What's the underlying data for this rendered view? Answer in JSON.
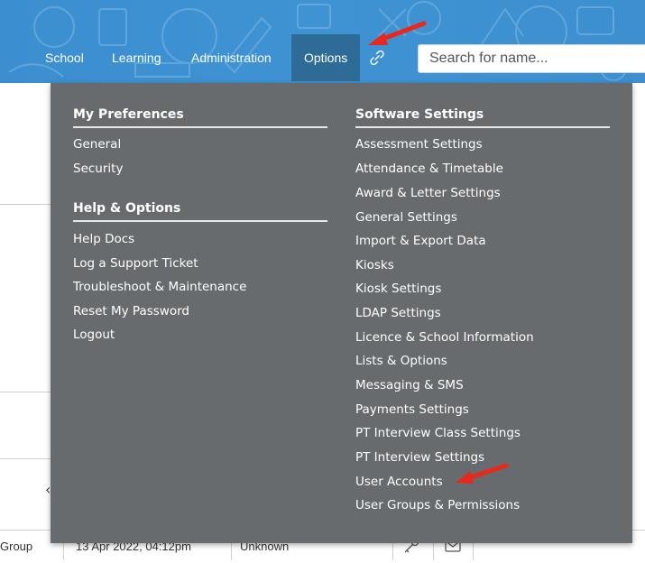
{
  "nav": {
    "items": [
      {
        "label": "School"
      },
      {
        "label": "Learning"
      },
      {
        "label": "Administration"
      },
      {
        "label": "Options"
      }
    ],
    "search_placeholder": "Search for name..."
  },
  "menu": {
    "my_preferences": {
      "heading": "My Preferences",
      "items": [
        "General",
        "Security"
      ]
    },
    "help_options": {
      "heading": "Help & Options",
      "items": [
        "Help Docs",
        "Log a Support Ticket",
        "Troubleshoot & Maintenance",
        "Reset My Password",
        "Logout"
      ]
    },
    "software_settings": {
      "heading": "Software Settings",
      "items": [
        "Assessment Settings",
        "Attendance & Timetable",
        "Award & Letter Settings",
        "General Settings",
        "Import & Export Data",
        "Kiosks",
        "Kiosk Settings",
        "LDAP Settings",
        "Licence & School Information",
        "Lists & Options",
        "Messaging & SMS",
        "Payments Settings",
        "PT Interview Class Settings",
        "PT Interview Settings",
        "User Accounts",
        "User Groups & Permissions"
      ]
    }
  },
  "background_row": {
    "cells": [
      "Group",
      "13 Apr 2022, 04:12pm",
      "Unknown"
    ]
  },
  "colors": {
    "header_blue": "#3d8fcf",
    "active_tab": "#2f6b97",
    "menu_bg": "#686b6d",
    "arrow_red": "#e8281c"
  },
  "icons": [
    "link-icon",
    "chevron-left-icon",
    "key-icon",
    "mail-icon",
    "arrow-annotation"
  ]
}
